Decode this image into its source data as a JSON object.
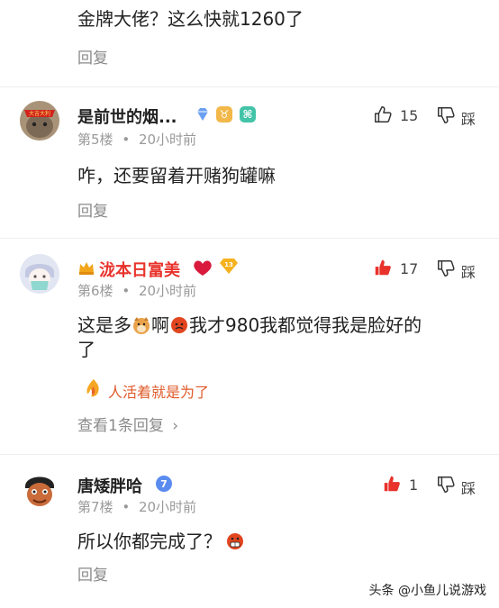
{
  "comment0": {
    "text": "金牌大佬？这么快就1260了",
    "reply": "回复"
  },
  "comment1": {
    "username": "是前世的烟...",
    "floor": "第5楼",
    "time": "20小时前",
    "likes": "15",
    "dislike": "踩",
    "text": "咋，还要留着开赌狗罐嘛",
    "reply": "回复",
    "avatar_banner": "大吉大利"
  },
  "comment2": {
    "username": "泷本日富美",
    "floor": "第6楼",
    "time": "20小时前",
    "likes": "17",
    "dislike": "踩",
    "level": "13",
    "text_a": "这是多",
    "text_b": "啊",
    "text_c": "我才980我都觉得我是脸好的",
    "text_d": "了",
    "sub_reply_author": "人活着就是为了",
    "view_replies": "查看1条回复",
    "chevron": "›"
  },
  "comment3": {
    "username": "唐矮胖哈",
    "floor": "第7楼",
    "time": "20小时前",
    "likes": "1",
    "dislike": "踩",
    "level": "7",
    "text": "所以你都完成了？",
    "reply": "回复"
  },
  "dot": "•",
  "watermark": "头条 @小鱼儿说游戏",
  "colors": {
    "accent_red": "#e8322b",
    "meta_gray": "#9a9a9a",
    "vip_gold": "#f2a51a",
    "badge_blue": "#5a8cf0"
  }
}
